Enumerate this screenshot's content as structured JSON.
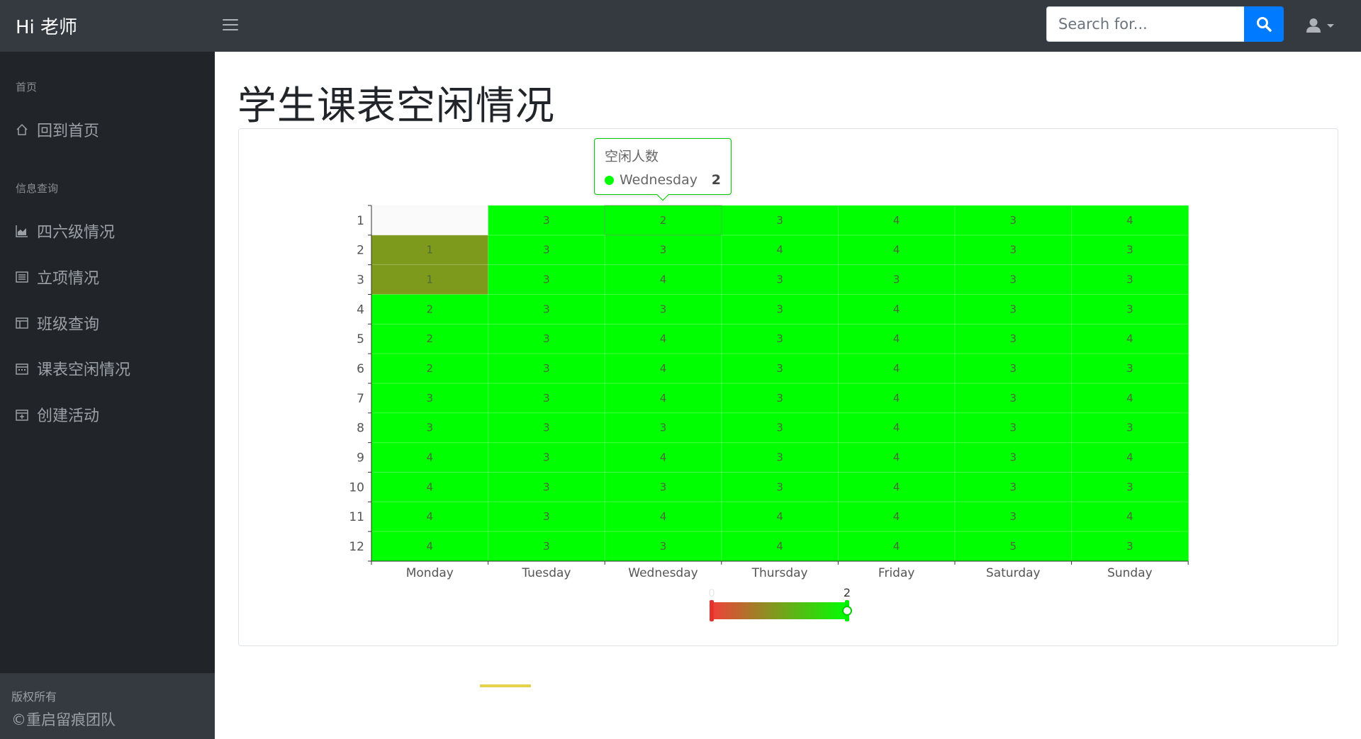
{
  "navbar": {
    "brand": "Hi 老师",
    "search_placeholder": "Search for..."
  },
  "sidebar": {
    "sections": [
      {
        "heading": "首页",
        "items": [
          {
            "label": "回到首页",
            "icon": "home-icon"
          }
        ]
      },
      {
        "heading": "信息查询",
        "items": [
          {
            "label": "四六级情况",
            "icon": "area-chart-icon"
          },
          {
            "label": "立项情况",
            "icon": "list-icon"
          },
          {
            "label": "班级查询",
            "icon": "table-icon"
          },
          {
            "label": "课表空闲情况",
            "icon": "calendar-icon"
          },
          {
            "label": "创建活动",
            "icon": "calendar-plus-icon"
          }
        ]
      }
    ],
    "footer_line1": "版权所有",
    "footer_line2": "©重启留痕团队"
  },
  "page": {
    "title": "学生课表空闲情况"
  },
  "tooltip": {
    "title": "空闲人数",
    "label": "Wednesday",
    "value": "2"
  },
  "chart_data": {
    "type": "heatmap",
    "series_name": "空闲人数",
    "x_categories": [
      "Monday",
      "Tuesday",
      "Wednesday",
      "Thursday",
      "Friday",
      "Saturday",
      "Sunday"
    ],
    "y_categories": [
      "1",
      "2",
      "3",
      "4",
      "5",
      "6",
      "7",
      "8",
      "9",
      "10",
      "11",
      "12"
    ],
    "values": [
      [
        null,
        3,
        2,
        3,
        4,
        3,
        4
      ],
      [
        1,
        3,
        3,
        4,
        4,
        3,
        3
      ],
      [
        1,
        3,
        4,
        3,
        3,
        3,
        3
      ],
      [
        2,
        3,
        3,
        3,
        4,
        3,
        3
      ],
      [
        2,
        3,
        4,
        3,
        4,
        3,
        4
      ],
      [
        2,
        3,
        4,
        3,
        4,
        3,
        3
      ],
      [
        3,
        3,
        4,
        3,
        4,
        3,
        4
      ],
      [
        3,
        3,
        3,
        3,
        4,
        3,
        3
      ],
      [
        4,
        3,
        4,
        3,
        4,
        3,
        4
      ],
      [
        4,
        3,
        3,
        3,
        4,
        3,
        3
      ],
      [
        4,
        3,
        4,
        4,
        4,
        3,
        4
      ],
      [
        4,
        3,
        3,
        4,
        4,
        5,
        3
      ]
    ],
    "visual_map": {
      "min_label": "0",
      "max_label": "2",
      "min": 0,
      "max": 2,
      "min_color": "#f0403a",
      "max_color": "#00ff00"
    },
    "colors": {
      "low": "#7e9a1c",
      "high": "#00ff00"
    },
    "highlighted_cell": {
      "x": "Wednesday",
      "y": "1"
    }
  }
}
